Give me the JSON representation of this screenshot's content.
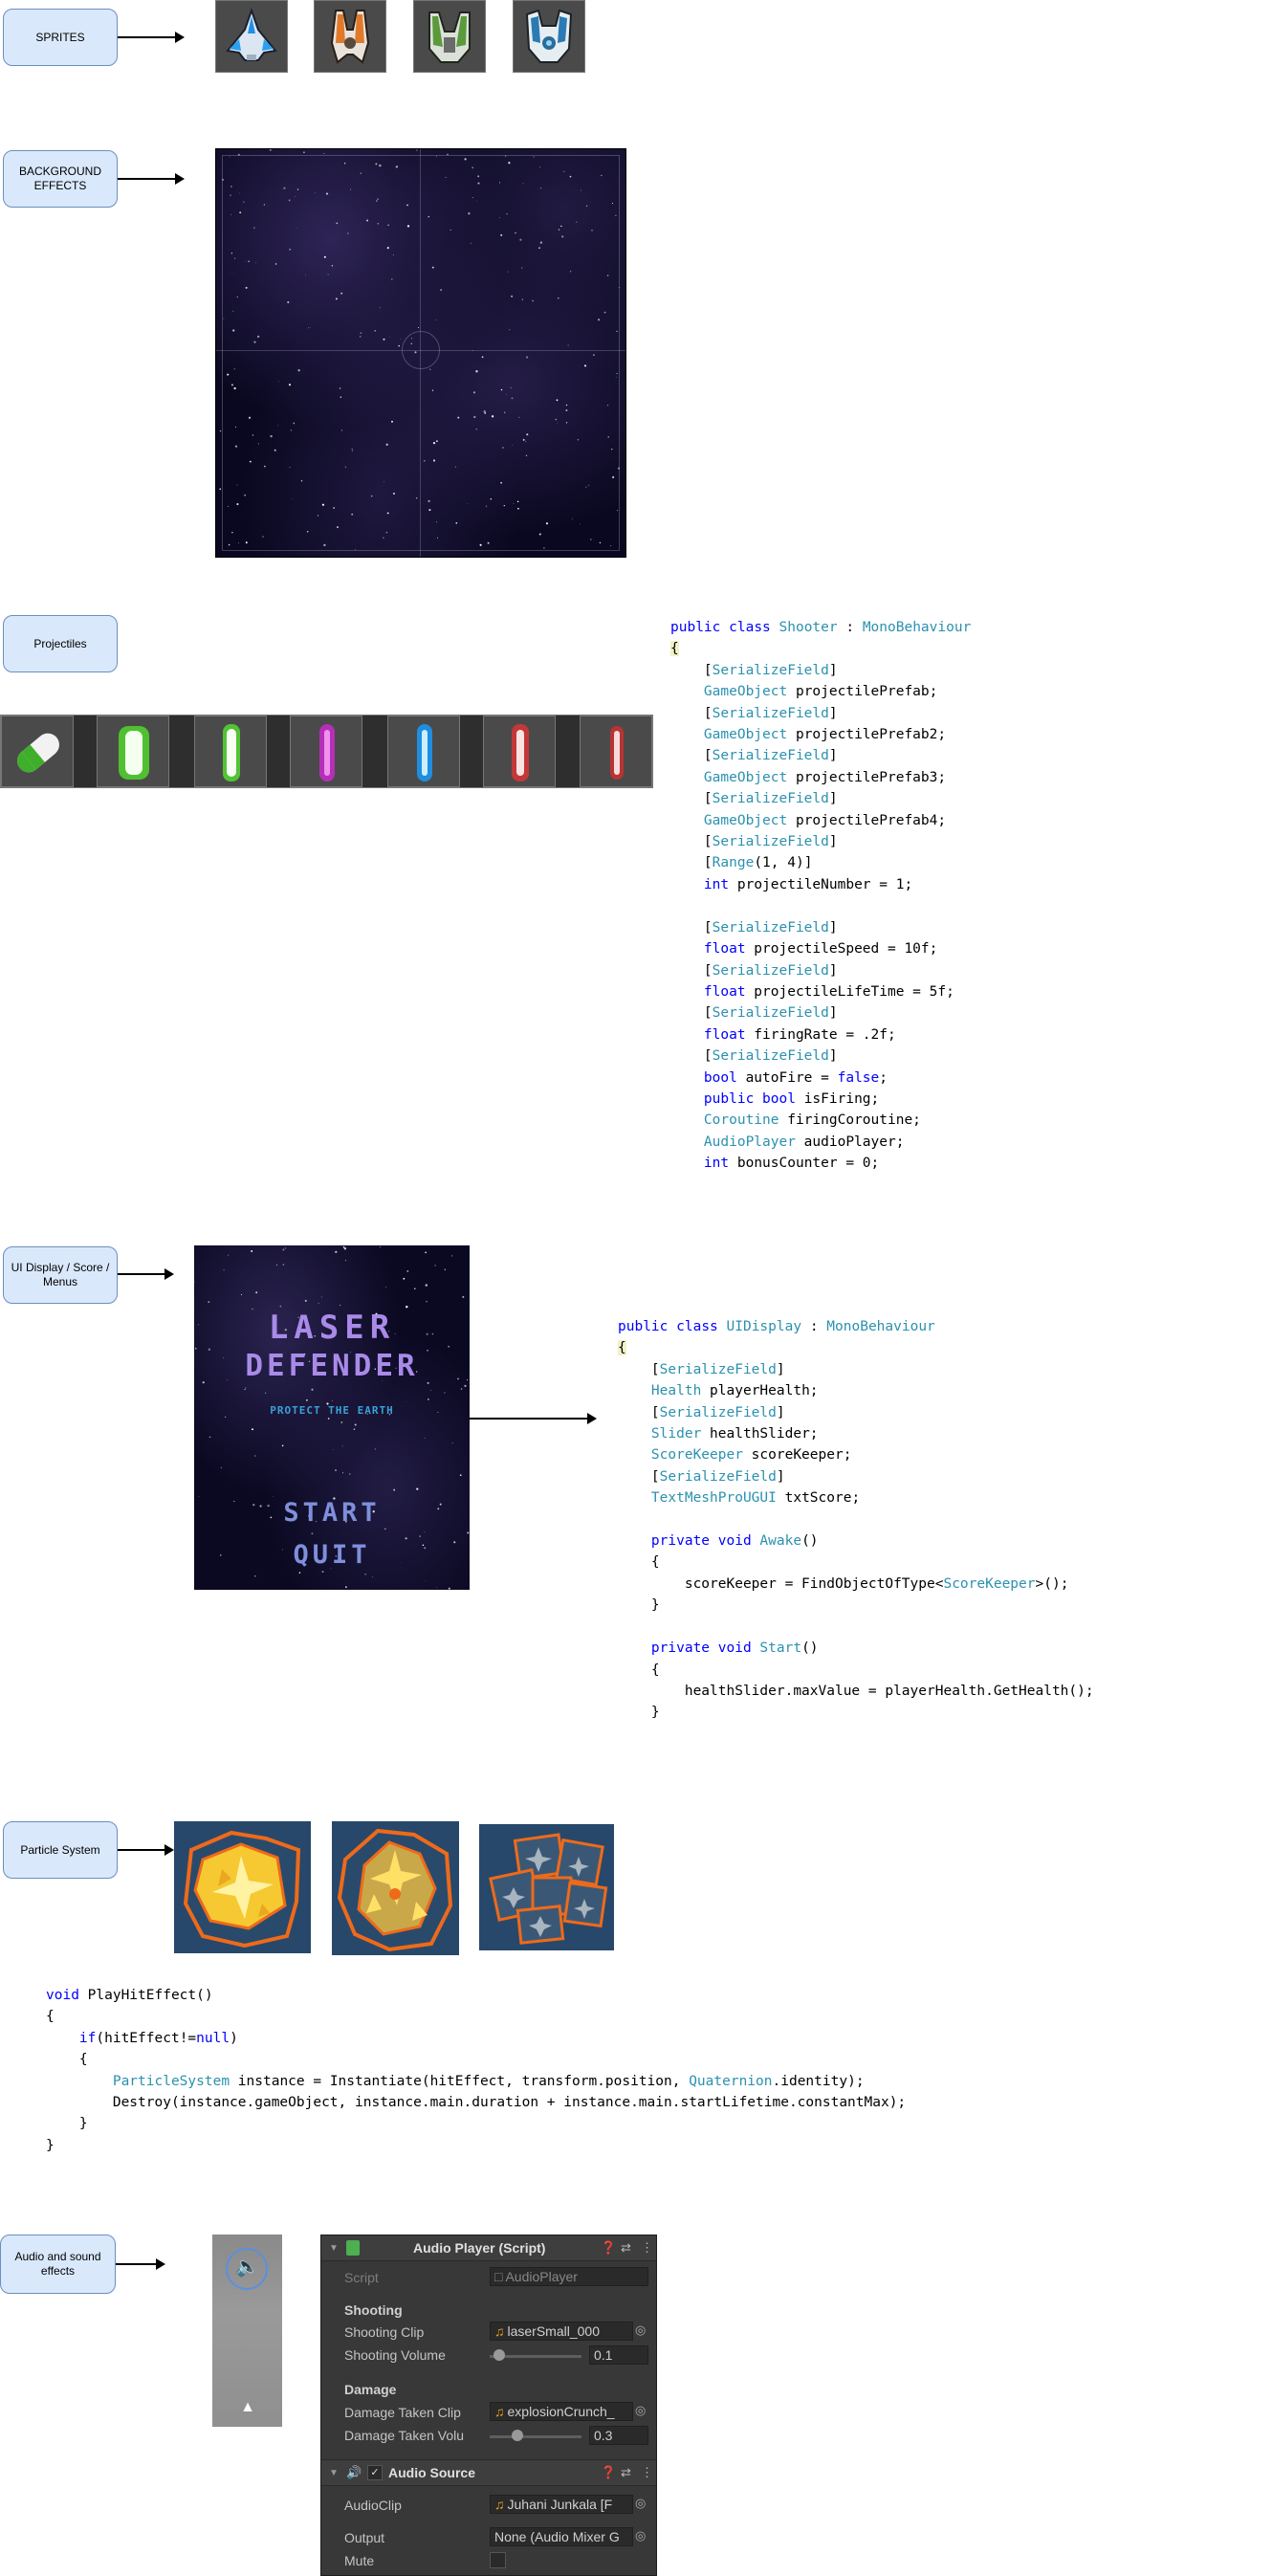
{
  "labels": {
    "sprites": "SPRITES",
    "background": "BACKGROUND\nEFFECTS",
    "projectiles": "Projectiles",
    "ui_display": "UI Display / Score / Menus",
    "particle": "Particle System",
    "audio": "Audio and sound effects"
  },
  "game_menu": {
    "title_line1": "LASER",
    "title_line2": "DEFENDER",
    "subtitle": "PROTECT THE EARTH",
    "start": "START",
    "quit": "QUIT"
  },
  "code": {
    "shooter": [
      "public class Shooter : MonoBehaviour",
      "{",
      "    [SerializeField]",
      "    GameObject projectilePrefab;",
      "    [SerializeField]",
      "    GameObject projectilePrefab2;",
      "    [SerializeField]",
      "    GameObject projectilePrefab3;",
      "    [SerializeField]",
      "    GameObject projectilePrefab4;",
      "    [SerializeField]",
      "    [Range(1, 4)]",
      "    int projectileNumber = 1;",
      "",
      "    [SerializeField]",
      "    float projectileSpeed = 10f;",
      "    [SerializeField]",
      "    float projectileLifeTime = 5f;",
      "    [SerializeField]",
      "    float firingRate = .2f;",
      "    [SerializeField]",
      "    bool autoFire = false;",
      "    public bool isFiring;",
      "    Coroutine firingCoroutine;",
      "    AudioPlayer audioPlayer;",
      "    int bonusCounter = 0;"
    ],
    "uidisplay": [
      "public class UIDisplay : MonoBehaviour",
      "{",
      "    [SerializeField]",
      "    Health playerHealth;",
      "    [SerializeField]",
      "    Slider healthSlider;",
      "    ScoreKeeper scoreKeeper;",
      "    [SerializeField]",
      "    TextMeshProUGUI txtScore;",
      "",
      "    private void Awake()",
      "    {",
      "        scoreKeeper = FindObjectOfType<ScoreKeeper>();",
      "    }",
      "",
      "    private void Start()",
      "    {",
      "        healthSlider.maxValue = playerHealth.GetHealth();",
      "    }"
    ],
    "hiteffect": [
      "void PlayHitEffect()",
      "{",
      "    if(hitEffect!=null)",
      "    {",
      "        ParticleSystem instance = Instantiate(hitEffect, transform.position, Quaternion.identity);",
      "        Destroy(instance.gameObject, instance.main.duration + instance.main.startLifetime.constantMax);",
      "    }",
      "}"
    ]
  },
  "inspector": {
    "component_title": "Audio Player (Script)",
    "script_label": "Script",
    "script_value": "AudioPlayer",
    "section_shooting": "Shooting",
    "shooting_clip_label": "Shooting Clip",
    "shooting_clip_value": "laserSmall_000",
    "shooting_volume_label": "Shooting Volume",
    "shooting_volume_value": "0.1",
    "shooting_volume_level": 0.1,
    "section_damage": "Damage",
    "damage_clip_label": "Damage Taken Clip",
    "damage_clip_value": "explosionCrunch_",
    "damage_volume_label": "Damage Taken Volu",
    "damage_volume_value": "0.3",
    "damage_volume_level": 0.3,
    "audio_source_title": "Audio Source",
    "audioclip_label": "AudioClip",
    "audioclip_value": "Juhani Junkala [F",
    "output_label": "Output",
    "output_value": "None (Audio Mixer G",
    "mute_label": "Mute"
  },
  "colors": {
    "label_box_fill": "#dae8fc",
    "label_box_stroke": "#6c8ebf",
    "code_keyword": "#0000ff",
    "code_type": "#2b91af",
    "menu_title": "#a98ae8",
    "menu_subtitle": "#3aa0d8",
    "menu_buttons": "#7f8fdc",
    "particle_outline": "#ee6a1a",
    "particle_bg": "#27486a"
  }
}
